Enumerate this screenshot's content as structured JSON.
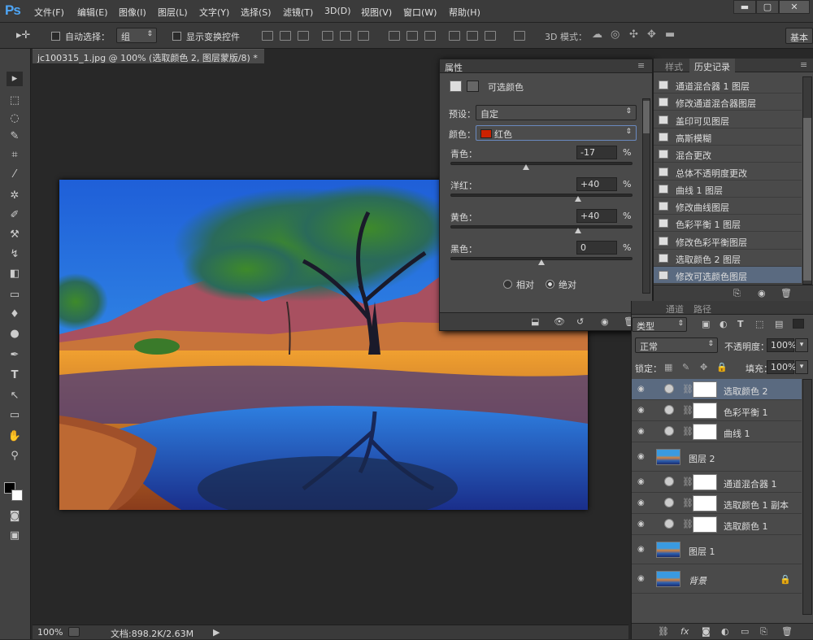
{
  "app": {
    "logo": "Ps"
  },
  "menu": [
    "文件(F)",
    "编辑(E)",
    "图像(I)",
    "图层(L)",
    "文字(Y)",
    "选择(S)",
    "滤镜(T)",
    "3D(D)",
    "视图(V)",
    "窗口(W)",
    "帮助(H)"
  ],
  "window_controls": {
    "minimize": "▬",
    "maximize": "▢",
    "close": "✕"
  },
  "options": {
    "auto_select_label": "自动选择：",
    "auto_select_value": "组",
    "show_transform_label": "显示变换控件",
    "mode_3d_label": "3D 模式：",
    "workspace": "基本"
  },
  "document": {
    "tab_title": "jc100315_1.jpg @ 100% (选取颜色 2, 图层蒙版/8) *",
    "close": "×"
  },
  "status": {
    "zoom": "100%",
    "doc_info": "文档:898.2K/2.63M"
  },
  "properties": {
    "tab": "属性",
    "title": "可选颜色",
    "preset_label": "预设：",
    "preset_value": "自定",
    "color_label": "颜色：",
    "color_value": "红色",
    "color_swatch": "#cc2200",
    "sliders": [
      {
        "label": "青色：",
        "value": "-17",
        "fraction": 0.415
      },
      {
        "label": "洋红：",
        "value": "+40",
        "fraction": 0.7
      },
      {
        "label": "黄色：",
        "value": "+40",
        "fraction": 0.7
      },
      {
        "label": "黑色：",
        "value": "0",
        "fraction": 0.5
      }
    ],
    "percent": "%",
    "mode_relative": "相对",
    "mode_absolute": "绝对",
    "mode_selected": "绝对"
  },
  "history": {
    "tabs": [
      "样式",
      "历史记录"
    ],
    "items": [
      "通道混合器 1 图层",
      "修改通道混合器图层",
      "盖印可见图层",
      "高斯模糊",
      "混合更改",
      "总体不透明度更改",
      "曲线 1 图层",
      "修改曲线图层",
      "色彩平衡 1 图层",
      "修改色彩平衡图层",
      "选取颜色 2 图层",
      "修改可选颜色图层"
    ]
  },
  "layers_panel": {
    "tabs": [
      "通道",
      "路径"
    ],
    "kind_label": "类型",
    "blend_mode": "正常",
    "opacity_label": "不透明度：",
    "opacity_value": "100%",
    "lock_label": "锁定：",
    "fill_label": "填充：",
    "fill_value": "100%",
    "layers": [
      {
        "name": "选取颜色 2",
        "kind": "adjustment",
        "selected": true
      },
      {
        "name": "色彩平衡 1",
        "kind": "adjustment",
        "selected": false
      },
      {
        "name": "曲线 1",
        "kind": "adjustment",
        "selected": false
      },
      {
        "name": "图层 2",
        "kind": "pixel",
        "selected": false
      },
      {
        "name": "通道混合器 1",
        "kind": "adjustment",
        "selected": false
      },
      {
        "name": "选取颜色 1 副本",
        "kind": "adjustment",
        "selected": false
      },
      {
        "name": "选取颜色 1",
        "kind": "adjustment",
        "selected": false
      },
      {
        "name": "图层 1",
        "kind": "pixel",
        "selected": false
      },
      {
        "name": "背景",
        "kind": "background",
        "selected": false
      }
    ],
    "bottom_icons": [
      "link-icon",
      "fx-icon",
      "mask-icon",
      "adjustment-icon",
      "group-icon",
      "new-layer-icon",
      "trash-icon"
    ]
  }
}
